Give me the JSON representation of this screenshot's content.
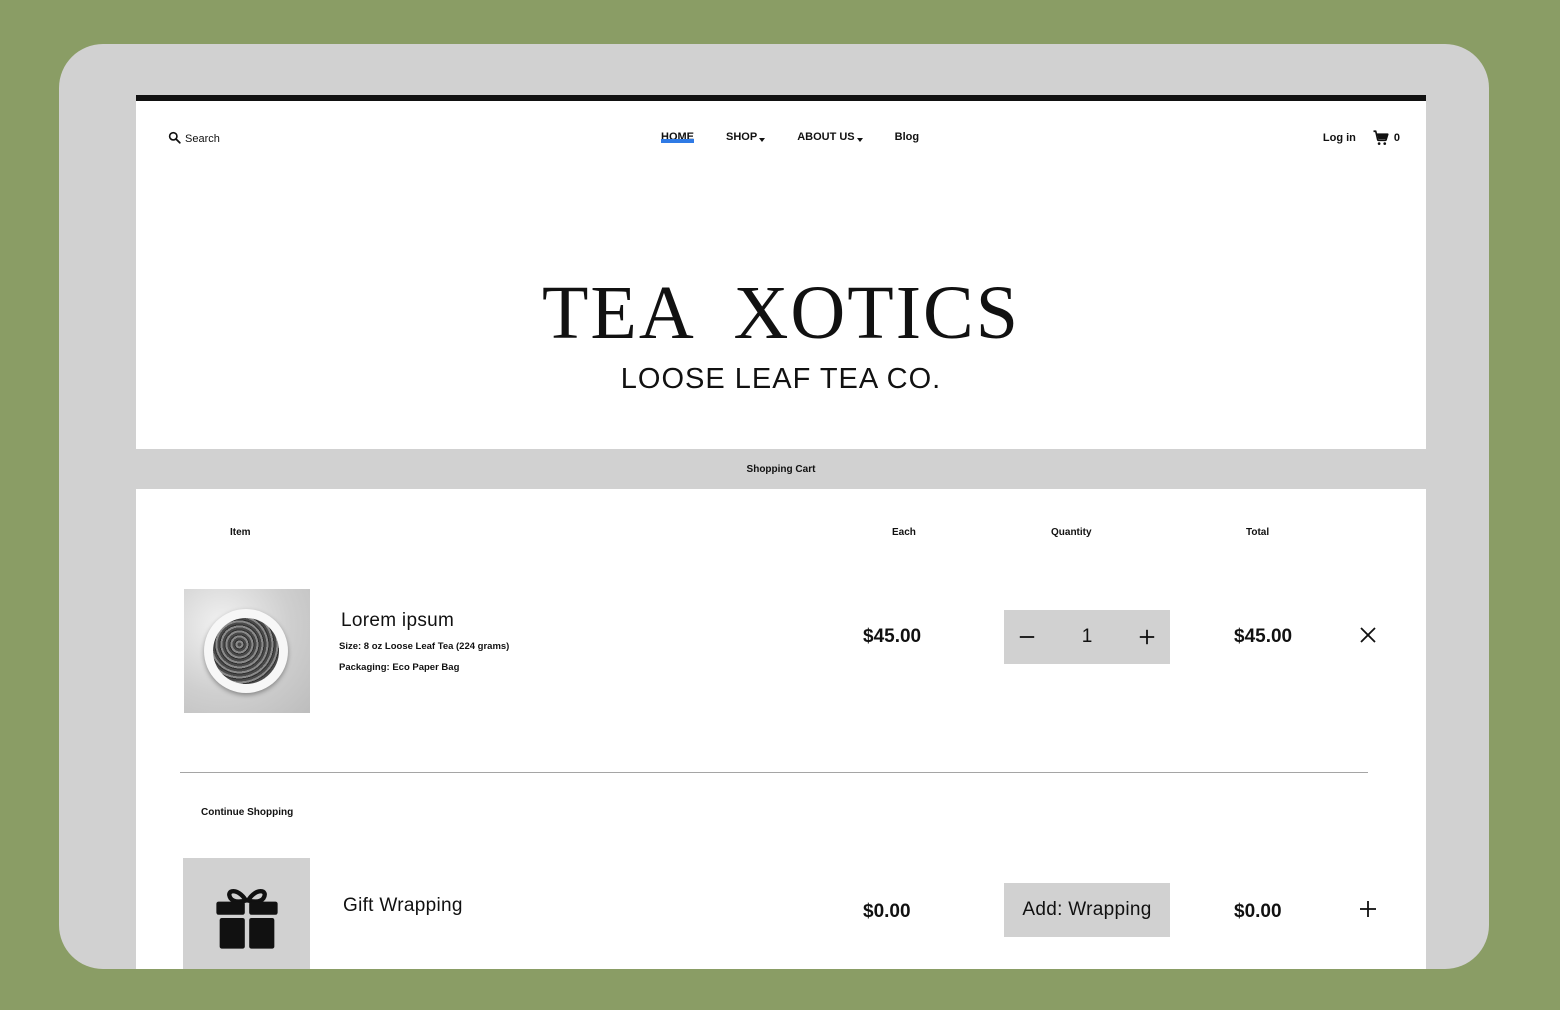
{
  "nav": {
    "search_label": "Search",
    "links": [
      "HOME",
      "SHOP",
      "ABOUT US",
      "Blog"
    ],
    "login_label": "Log in",
    "cart_count": "0"
  },
  "hero": {
    "title": "TEA  XOTICS",
    "subtitle": "LOOSE LEAF TEA CO."
  },
  "cart": {
    "band_label": "Shopping Cart",
    "headers": {
      "item": "Item",
      "each": "Each",
      "quantity": "Quantity",
      "total": "Total"
    },
    "item": {
      "name": "Lorem ipsum",
      "size": "Size:  8 oz Loose Leaf Tea (224 grams)",
      "packaging": "Packaging: Eco Paper Bag",
      "each": "$45.00",
      "quantity": "1",
      "total": "$45.00"
    },
    "continue_label": "Continue Shopping",
    "gift": {
      "name": "Gift Wrapping",
      "each": "$0.00",
      "button_label": "Add: Wrapping",
      "total": "$0.00"
    }
  },
  "colors": {
    "background": "#8a9d65",
    "frame": "#d1d1d1",
    "accent": "#2f7ae5"
  },
  "icons": [
    "search-icon",
    "caret-down-icon",
    "cart-icon",
    "minus-icon",
    "plus-icon",
    "close-icon",
    "gift-icon"
  ]
}
